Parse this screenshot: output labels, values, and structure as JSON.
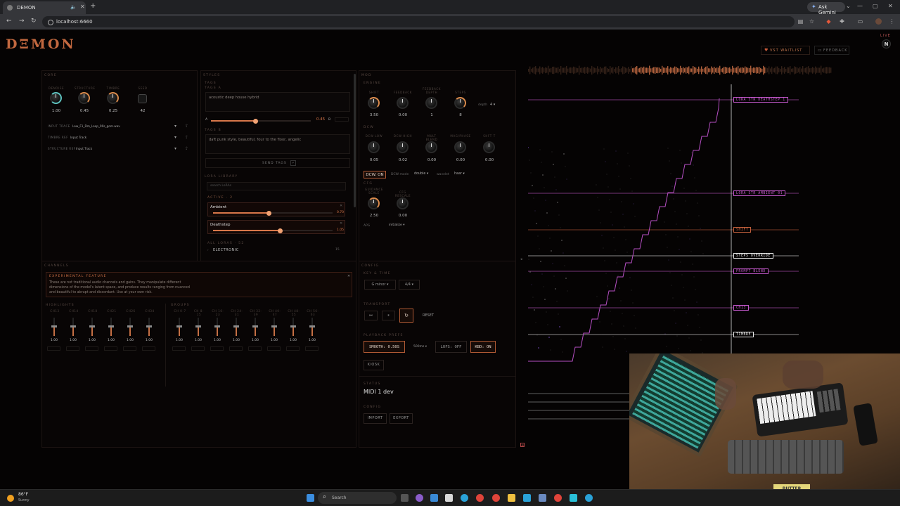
{
  "browser": {
    "tab_title": "DEMON",
    "url": "localhost:6660",
    "gemini_label": "Ask Gemini"
  },
  "header": {
    "logo": "DΞMON",
    "vst_label": "VST WAITLIST",
    "feedback_label": "FEEDBACK",
    "live_label": "LIVE",
    "avatar_initial": "N"
  },
  "core": {
    "title": "CORE",
    "knobs": [
      {
        "label": "DENOISE",
        "value": "1.00"
      },
      {
        "label": "STRUCTURE",
        "value": "0.45"
      },
      {
        "label": "TIMBRE",
        "value": "0.25"
      },
      {
        "label": "SEED",
        "value": "42"
      }
    ],
    "input_trace": {
      "label": "INPUT TRACE",
      "value": "Low_F1_Dm_Loop_90s_gom.wav"
    },
    "timbre_ref": {
      "label": "TIMBRE REF",
      "value": "Input Track"
    },
    "structure_ref": {
      "label": "STRUCTURE REF",
      "value": "Input Track"
    }
  },
  "styles": {
    "title": "STYLES",
    "tags_title": "TAGS",
    "tags_a_label": "TAGS A",
    "tags_a_text": "acoustic deep house hybrid",
    "blend_left": "A",
    "blend_value": "0.45",
    "blend_right": "B",
    "blend_fraction": 0.45,
    "tags_b_label": "TAGS B",
    "tags_b_text": "daft punk style, beautiful, four to the floor, angelic",
    "send_tags_label": "SEND TAGS",
    "lora_library_label": "LORA LIBRARY",
    "lora_search_placeholder": "search LoRAs",
    "active_label": "ACTIVE · 2",
    "active_loras": [
      {
        "name": "Ambient",
        "value": "0.70",
        "fraction": 0.47
      },
      {
        "name": "Deathstep",
        "value": "1.05",
        "fraction": 0.56
      }
    ],
    "all_loras_label": "ALL LORAS · 52",
    "category": "ELECTRONIC",
    "category_count": "15"
  },
  "mod": {
    "title": "MOD",
    "engine_label": "ENGINE",
    "engine_knobs": [
      {
        "label": "SHIFT",
        "value": "3.50"
      },
      {
        "label": "FEEDBACK",
        "value": "0.00"
      },
      {
        "label": "FEEDBACK DEPTH",
        "value": "1"
      },
      {
        "label": "STEPS",
        "value": "8"
      }
    ],
    "depth_label": "depth",
    "depth_value": "4",
    "dcw_label": "DCW",
    "dcw_knobs": [
      {
        "label": "DCW LOW",
        "value": "0.05"
      },
      {
        "label": "DCW HIGH",
        "value": "0.02"
      },
      {
        "label": "MULT BLEND",
        "value": "0.00"
      },
      {
        "label": "MAG/PHASE",
        "value": "0.00"
      },
      {
        "label": "SHFT T",
        "value": "0.00"
      }
    ],
    "dcw_toggle": "DCW: ON",
    "dcw_mode_label": "DCW mode",
    "dcw_mode_value": "double",
    "wavelet_label": "wavelet",
    "wavelet_value": "haar",
    "cfg_label": "CFG",
    "cfg_knobs": [
      {
        "label": "GUIDANCE SCALE",
        "value": "2.50"
      },
      {
        "label": "CFG RESCALE",
        "value": "0.00"
      }
    ],
    "apg_label": "APG",
    "apg_value": "initialize"
  },
  "channels": {
    "title": "CHANNELS",
    "warning_title": "EXPERIMENTAL FEATURE",
    "warning_text": "These are not traditional audio channels and gains. They manipulate different dimensions of the model's latent space, and produce results ranging from nuanced and beautiful to abrupt and discordant. Use at your own risk.",
    "highlights_label": "HIGHLIGHTS",
    "highlights": [
      "CH13",
      "CH14",
      "CH18",
      "CH21",
      "CH26",
      "CH34"
    ],
    "groups_label": "GROUPS",
    "groups": [
      "CH 0-7",
      "CH 8-15",
      "CH 16-23",
      "CH 24-31",
      "CH 32-39",
      "CH 40-47",
      "CH 48-55",
      "CH 56-63"
    ],
    "gain_value": "1.00",
    "gain_fraction": 0.55
  },
  "config": {
    "title": "CONFIG",
    "key_time_label": "KEY & TIME",
    "key_value": "G minor",
    "time_sig_value": "4/4",
    "transport_label": "TRANSPORT",
    "reset_label": "RESET",
    "playback_label": "PLAYBACK PREFS",
    "smooth_label": "SMOOTH: 0.50S",
    "smooth_select": "500ms",
    "lufs_label": "LUFS: OFF",
    "kbd_label": "KBD: ON",
    "kiosk_label": "KIOSK",
    "status_label": "STATUS",
    "status_value": "MIDI 1 dev",
    "config_label": "CONFIG",
    "import_label": "IMPORT",
    "export_label": "EXPORT"
  },
  "visualizer": {
    "tracks": [
      {
        "label": "LORA STR DEATHSTEP 1",
        "color": "#c257c9"
      },
      {
        "label": "LORA STR AMBIENT 01",
        "color": "#c257c9"
      },
      {
        "label": "SHIFT",
        "color": "#c4603c"
      },
      {
        "label": "STEPS OVERRIDE",
        "color": "#e6e6e6"
      },
      {
        "label": "PROMPT BLEND",
        "color": "#c257c9"
      },
      {
        "label": "CH13",
        "color": "#c257c9"
      },
      {
        "label": "TIMBRE",
        "color": "#e6e6e6"
      }
    ],
    "accent": "#d8774a"
  },
  "taskbar": {
    "weather_temp": "86°F",
    "weather_desc": "Sunny",
    "search_label": "Search"
  },
  "webcam": {
    "tape_label": "BUTTER"
  }
}
